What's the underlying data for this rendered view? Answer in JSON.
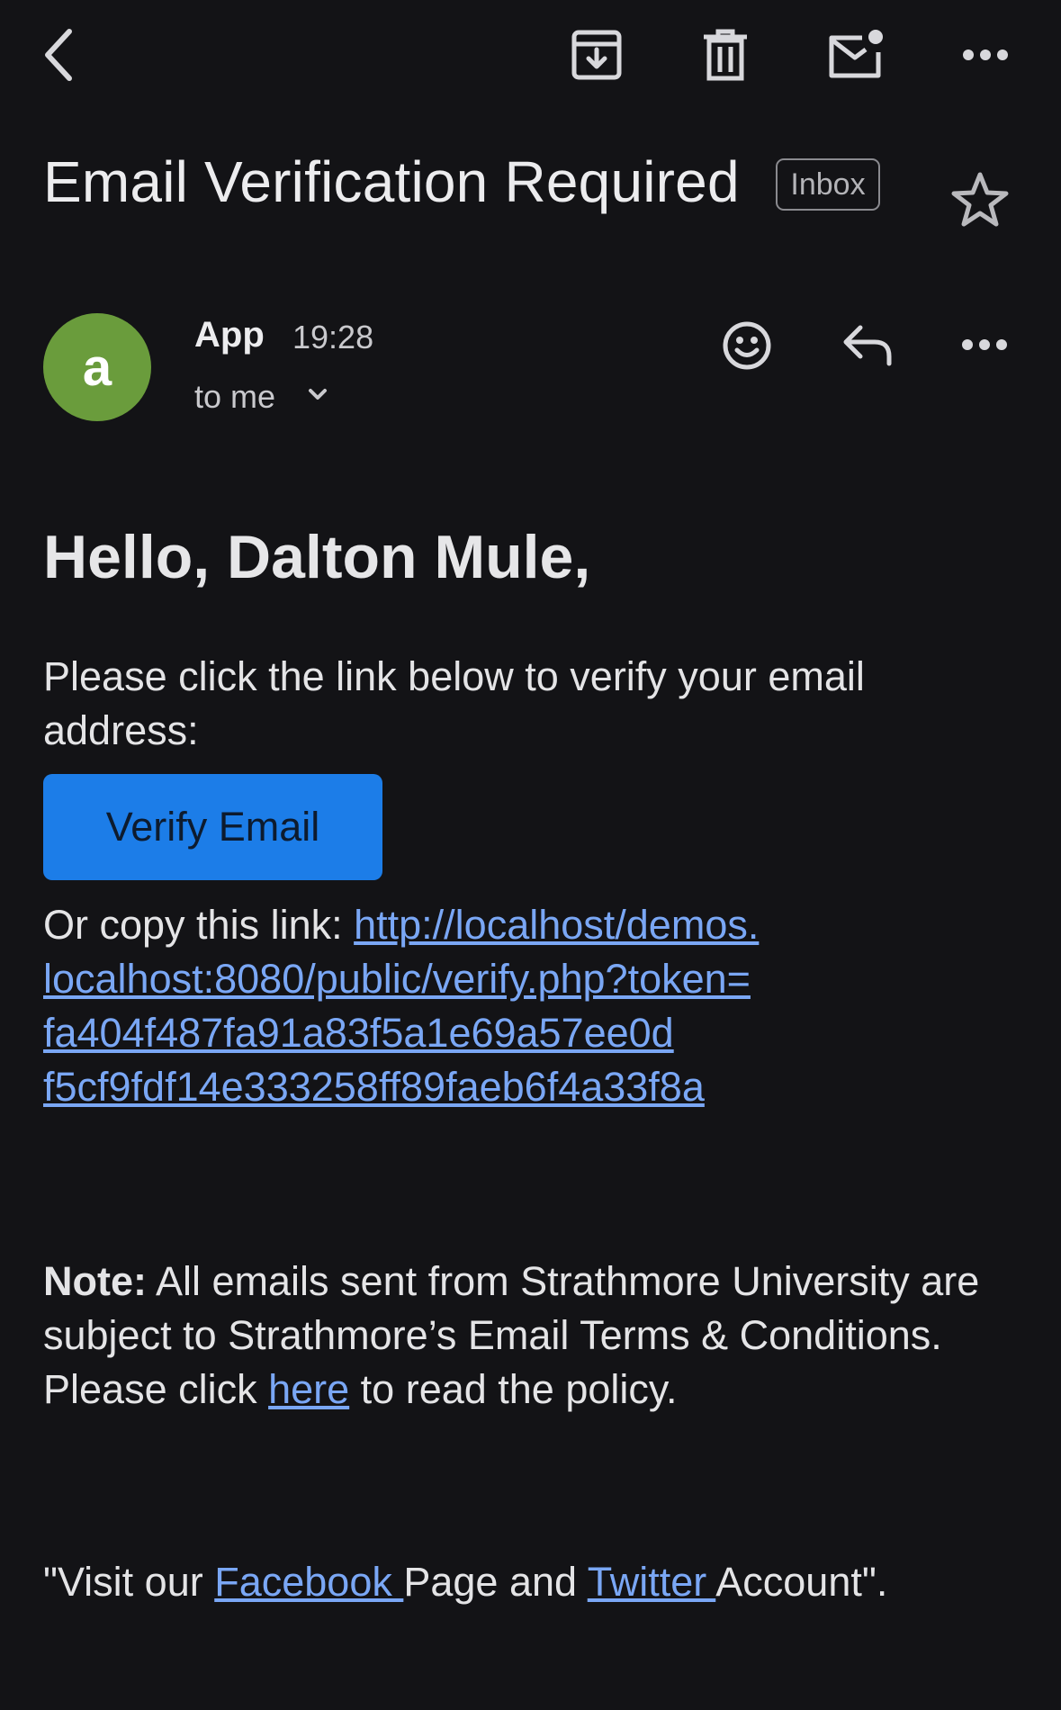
{
  "toolbar": {
    "back_icon": "back-arrow-icon",
    "archive_icon": "archive-icon",
    "delete_icon": "trash-icon",
    "mark_unread_icon": "mark-unread-icon",
    "more_icon": "more-horizontal-icon"
  },
  "email": {
    "subject": "Email Verification Required",
    "label": "Inbox",
    "sender": {
      "avatar_letter": "a",
      "avatar_color": "#6a9c3c",
      "name": "App",
      "time": "19:28",
      "recipient": "to me"
    },
    "greeting": "Hello, Dalton Mule,",
    "instruction": "Please click the link below to verify your email address:",
    "verify_button": "Verify Email",
    "copy_link_prefix": "Or copy this link: ",
    "verify_link_lines": [
      "http://localhost/demos.",
      "localhost:8080/public/verify.php?token=",
      "fa404f487fa91a83f5a1e69a57ee0d",
      "f5cf9fdf14e333258ff89faeb6f4a33f8a"
    ],
    "note": {
      "label": "Note:",
      "text_before": " All emails sent from Strathmore University are subject to Strathmore’s Email Terms & Conditions. Please click ",
      "link": "here",
      "text_after": " to read the policy."
    },
    "footer": {
      "part1": "\"Visit our ",
      "facebook": "Facebook ",
      "part2": "Page and ",
      "twitter": "Twitter ",
      "part3": "Account\"."
    }
  },
  "colors": {
    "background": "#131316",
    "accent_button": "#1c7de8",
    "link": "#7aa7f5"
  }
}
